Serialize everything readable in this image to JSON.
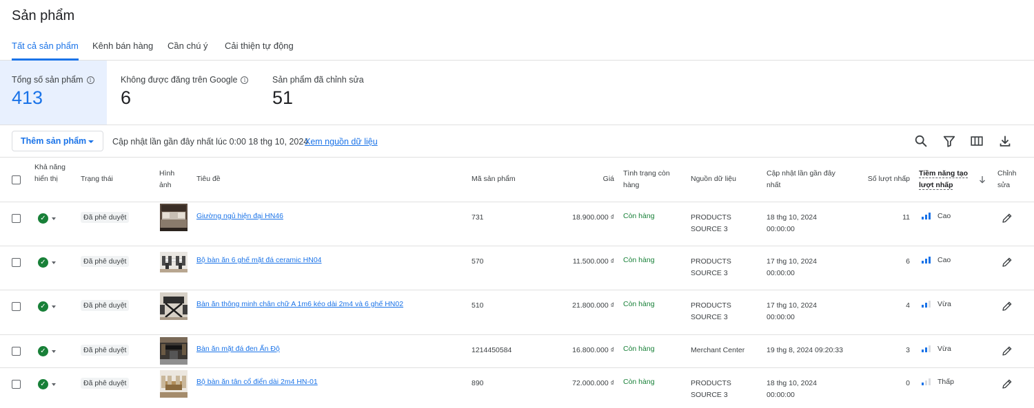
{
  "page": {
    "title": "Sản phẩm"
  },
  "tabs": [
    {
      "label": "Tất cả sản phẩm"
    },
    {
      "label": "Kênh bán hàng"
    },
    {
      "label": "Cần chú ý"
    },
    {
      "label": "Cải thiện tự động"
    }
  ],
  "stats": [
    {
      "label": "Tổng số sản phẩm",
      "value": "413"
    },
    {
      "label": "Không được đăng trên Google",
      "value": "6"
    },
    {
      "label": "Sản phẩm đã chỉnh sửa",
      "value": "51"
    }
  ],
  "toolbar": {
    "add_label": "Thêm sản phẩm",
    "last_update": "Cập nhật lần gần đây nhất lúc 0:00 18 thg 10, 2024",
    "source_link": "Xem nguồn dữ liệu"
  },
  "columns": {
    "visibility": "Khả năng hiển thị",
    "status": "Trạng thái",
    "image": "Hình ảnh",
    "title": "Tiêu đề",
    "id": "Mã sản phẩm",
    "price": "Giá",
    "availability": "Tình trạng còn hàng",
    "source": "Nguồn dữ liệu",
    "updated": "Cập nhật lần gần đây nhất",
    "clicks": "Số lượt nhấp",
    "potential": "Tiềm năng tạo lượt nhấp",
    "edit": "Chỉnh sửa"
  },
  "rows": [
    {
      "status": "Đã phê duyệt",
      "title": "Giường ngủ hiện đại HN46",
      "id": "731",
      "price": "18.900.000 ₫",
      "availability": "Còn hàng",
      "source": "PRODUCTS SOURCE 3",
      "updated": "18 thg 10, 2024 00:00:00",
      "clicks": "11",
      "potential": "Cao",
      "potential_level": 3
    },
    {
      "status": "Đã phê duyệt",
      "title": "Bộ bàn ăn 6 ghế mặt đá ceramic HN04",
      "id": "570",
      "price": "11.500.000 ₫",
      "availability": "Còn hàng",
      "source": "PRODUCTS SOURCE 3",
      "updated": "17 thg 10, 2024 00:00:00",
      "clicks": "6",
      "potential": "Cao",
      "potential_level": 3
    },
    {
      "status": "Đã phê duyệt",
      "title": "Bàn ăn thông minh chân chữ A 1m6 kéo dài 2m4 và 6 ghế HN02",
      "id": "510",
      "price": "21.800.000 ₫",
      "availability": "Còn hàng",
      "source": "PRODUCTS SOURCE 3",
      "updated": "17 thg 10, 2024 00:00:00",
      "clicks": "4",
      "potential": "Vừa",
      "potential_level": 2
    },
    {
      "status": "Đã phê duyệt",
      "title": "Bàn ăn mặt đá đen Ấn Độ",
      "id": "1214450584",
      "price": "16.800.000 ₫",
      "availability": "Còn hàng",
      "source": "Merchant Center",
      "updated": "19 thg 8, 2024 09:20:33",
      "clicks": "3",
      "potential": "Vừa",
      "potential_level": 2
    },
    {
      "status": "Đã phê duyệt",
      "title": "Bộ bàn ăn tân cổ điển dài 2m4 HN-01",
      "id": "890",
      "price": "72.000.000 ₫",
      "availability": "Còn hàng",
      "source": "PRODUCTS SOURCE 3",
      "updated": "18 thg 10, 2024 00:00:00",
      "clicks": "0",
      "potential": "Thấp",
      "potential_level": 1
    }
  ],
  "icons": {
    "search": "search-icon",
    "filter": "filter-icon",
    "columns": "columns-icon",
    "download": "download-icon",
    "info": "info-icon",
    "edit": "pencil-icon",
    "check": "check-circle-icon",
    "sort": "arrow-down-icon"
  },
  "colors": {
    "accent": "#1a73e8",
    "success": "#188038",
    "active_bg": "#e8f0fe"
  }
}
